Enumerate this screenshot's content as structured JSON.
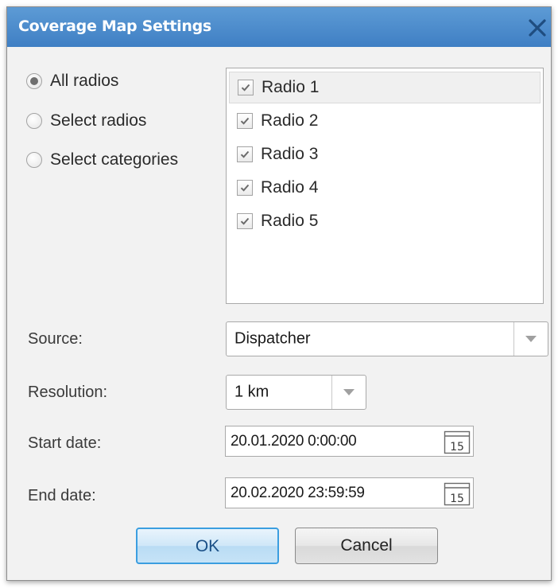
{
  "dialog": {
    "title": "Coverage Map Settings"
  },
  "filter": {
    "options": [
      {
        "label": "All radios",
        "checked": true
      },
      {
        "label": "Select radios",
        "checked": false
      },
      {
        "label": "Select categories",
        "checked": false
      }
    ]
  },
  "radios": {
    "items": [
      {
        "label": "Radio 1",
        "checked": true,
        "selected": true
      },
      {
        "label": "Radio 2",
        "checked": true,
        "selected": false
      },
      {
        "label": "Radio 3",
        "checked": true,
        "selected": false
      },
      {
        "label": "Radio 4",
        "checked": true,
        "selected": false
      },
      {
        "label": "Radio 5",
        "checked": true,
        "selected": false
      }
    ]
  },
  "source": {
    "label": "Source:",
    "value": "Dispatcher"
  },
  "resolution": {
    "label": "Resolution:",
    "value": "1 km"
  },
  "start_date": {
    "label": "Start date:",
    "value": "20.01.2020 0:00:00"
  },
  "end_date": {
    "label": "End date:",
    "value": "20.02.2020 23:59:59"
  },
  "calendar": {
    "day": "15"
  },
  "buttons": {
    "ok": "OK",
    "cancel": "Cancel"
  },
  "colors": {
    "titlebar": "#4a8ccd",
    "title_text": "#ffffff",
    "close_icon": "#1f4d80",
    "ok_border": "#3b9ee0"
  },
  "icons": {
    "close": "close-icon",
    "dropdown": "chevron-down-icon",
    "calendar": "calendar-icon",
    "check": "checkmark-icon"
  }
}
